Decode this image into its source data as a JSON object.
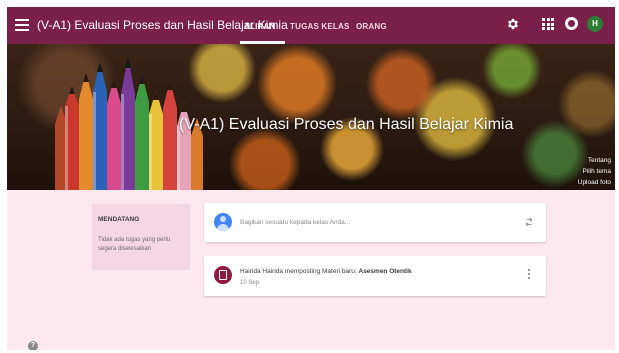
{
  "header": {
    "class_title": "(V-A1) Evaluasi Proses dan Hasil Belajar Kimia",
    "tabs": [
      {
        "label": "ALIRAN",
        "active": true
      },
      {
        "label": "TUGAS KELAS",
        "active": false
      },
      {
        "label": "ORANG",
        "active": false
      }
    ],
    "avatar_initial": "H",
    "icons": [
      "menu-icon",
      "gear-icon",
      "apps-grid-icon",
      "circle-icon"
    ]
  },
  "banner": {
    "title": "(V-A1) Evaluasi Proses dan Hasil Belajar Kimia",
    "links": [
      "Tentang",
      "Pilih tema",
      "Upload foto"
    ]
  },
  "upcoming": {
    "title": "MENDATANG",
    "text": "Tidak ada tugas yang perlu segera diselesaikan"
  },
  "share": {
    "placeholder": "Bagikan sesuatu kepada kelas Anda..."
  },
  "post": {
    "author_text": "Hairida Hairida memposting Materi baru: ",
    "material_title": "Asesmen Otentik",
    "date": "10 Sep"
  },
  "colors": {
    "theme": "#7b1f4b",
    "page_background": "#fde8ef",
    "avatar": "#2e7d32",
    "post_icon": "#8e1b3f"
  }
}
